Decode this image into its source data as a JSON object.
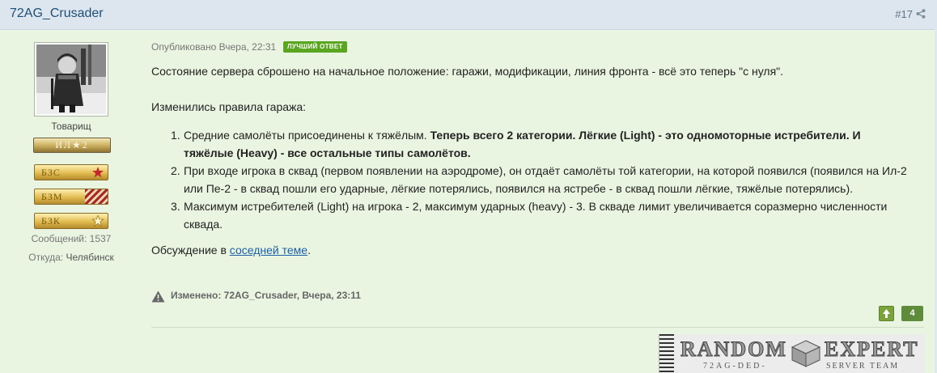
{
  "header": {
    "author": "72AG_Crusader",
    "post_number": "#17",
    "share_icon": "share-icon"
  },
  "author_panel": {
    "rank_title": "Товарищ",
    "rank_bar_label": "ИЛ★2",
    "awards": [
      {
        "label": "БЗС",
        "icon": "red-star-icon"
      },
      {
        "label": "БЗМ",
        "icon": "stripes-icon"
      },
      {
        "label": "БЗК",
        "icon": "gold-star-icon"
      }
    ],
    "messages_label": "Сообщений:",
    "messages_value": "1537",
    "location_label": "Откуда:",
    "location_value": "Челябинск"
  },
  "post": {
    "published": "Опубликовано Вчера, 22:31",
    "best_answer_badge": "ЛУЧШИЙ ОТВЕТ",
    "intro": "Состояние сервера сброшено на начальное положение: гаражи, модификации, линия фронта - всё это теперь \"с нуля\".",
    "rules_heading": "Изменились правила гаража:",
    "rules": [
      {
        "num": "1.",
        "plain": "Средние самолёты присоединены к тяжёлым. ",
        "bold_line1": "Теперь всего 2 категории. Лёгкие (Light) - это одномоторные истребители. И",
        "bold_line2": "тяжёлые (Heavy) - все остальные типы самолётов."
      },
      {
        "num": "2.",
        "line1": "При входе игрока в сквад (первом появлении на аэродроме), он отдаёт самолёты той категории, на которой появился (появился на Ил-2",
        "line2": "или Пе-2 - в сквад пошли его ударные, лёгкие потерялись, появился на ястребе - в сквад пошли лёгкие, тяжёлые потерялись)."
      },
      {
        "num": "3.",
        "line1": "Максимум истребителей (Light) на игрока - 2, максимум ударных (heavy)  - 3. В скваде лимит увеличивается соразмерно численности",
        "line2": "сквада."
      }
    ],
    "discussion_prefix": "Обсуждение в ",
    "discussion_link": "соседней теме",
    "discussion_suffix": ".",
    "edited": "Изменено: 72AG_Crusader, Вчера, 23:11",
    "vote_count": "4"
  },
  "signature": {
    "word1": "RANDOM",
    "word2": "EXPERT",
    "sub1": "72AG-DED-",
    "sub2": "SERVER TEAM"
  },
  "colors": {
    "post_background": "#e9f5e1",
    "header_background": "#dde6ee",
    "best_answer": "#5aa620",
    "link": "#1a5fa5"
  }
}
